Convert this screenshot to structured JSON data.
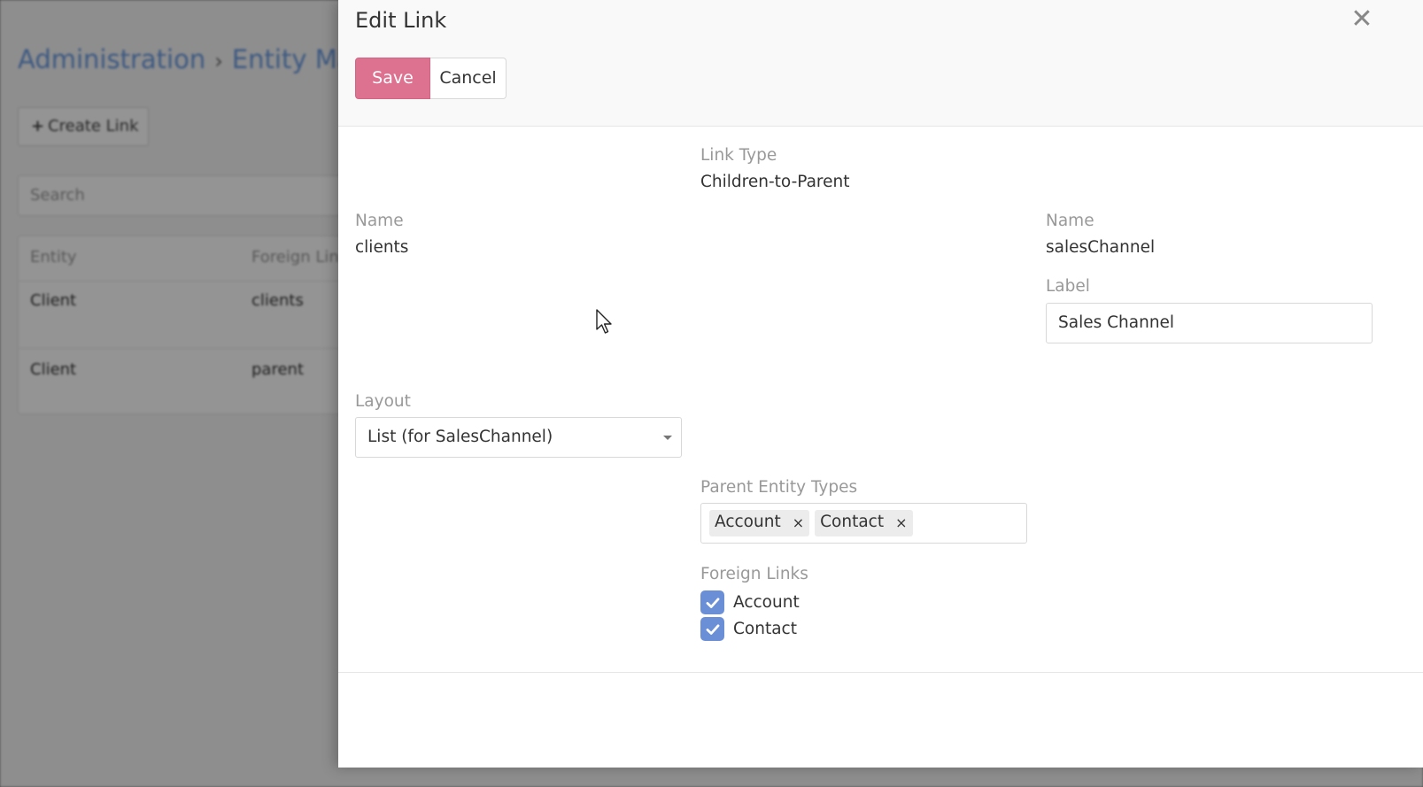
{
  "background": {
    "breadcrumb": {
      "root": "Administration",
      "separator": "›",
      "current": "Entity Mar"
    },
    "create_link_label": "Create Link",
    "search_placeholder": "Search",
    "table": {
      "headers": [
        "Entity",
        "Foreign Lin"
      ],
      "rows": [
        {
          "entity": "Client",
          "foreign_link": "clients"
        },
        {
          "entity": "Client",
          "foreign_link": "parent"
        }
      ]
    }
  },
  "modal": {
    "title": "Edit Link",
    "save_label": "Save",
    "cancel_label": "Cancel",
    "close_symbol": "✕",
    "link_type": {
      "label": "Link Type",
      "value": "Children-to-Parent"
    },
    "left": {
      "name_label": "Name",
      "name_value": "clients",
      "layout_label": "Layout",
      "layout_value": "List (for SalesChannel)"
    },
    "right": {
      "name_label": "Name",
      "name_value": "salesChannel",
      "label_label": "Label",
      "label_value": "Sales Channel"
    },
    "parent_entity_types": {
      "label": "Parent Entity Types",
      "tags": [
        "Account",
        "Contact"
      ],
      "remove_symbol": "×"
    },
    "foreign_links": {
      "label": "Foreign Links",
      "items": [
        {
          "label": "Account",
          "checked": true
        },
        {
          "label": "Contact",
          "checked": true
        }
      ]
    }
  },
  "colors": {
    "save_button": "#dd7190",
    "checkbox": "#6b8fd6",
    "breadcrumb_link": "#6a9ae0"
  }
}
